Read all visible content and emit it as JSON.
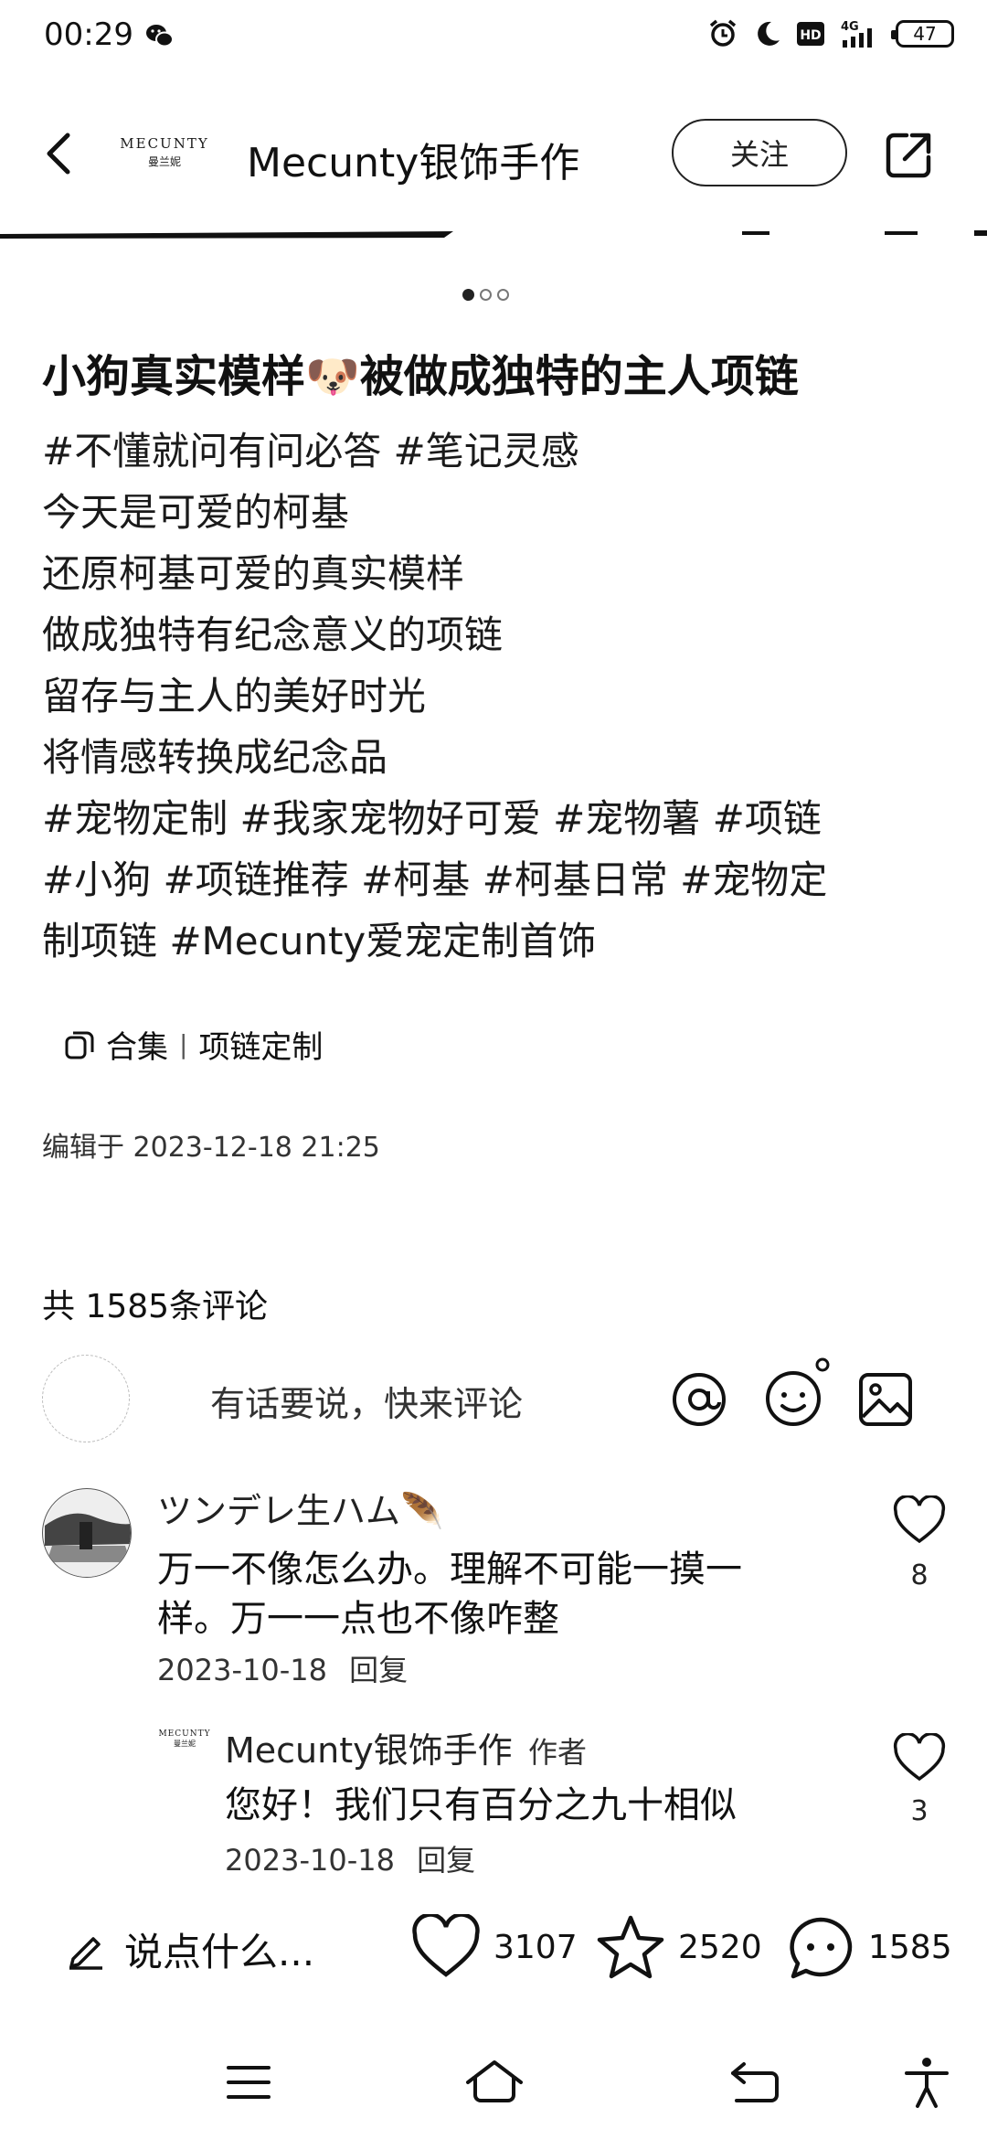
{
  "status_bar": {
    "time": "00:29",
    "network": "4G",
    "hd": "HD",
    "battery": "47"
  },
  "header": {
    "brand_logo_line1": "MECUNTY",
    "brand_logo_line2": "曼兰妮",
    "author_name": "Mecunty银饰手作",
    "follow_label": "关注"
  },
  "post": {
    "title": "小狗真实模样🐶被做成独特的主人项链",
    "body_lines": [
      "#不懂就问有问必答 #笔记灵感",
      "今天是可爱的柯基",
      "还原柯基可爱的真实模样",
      "做成独特有纪念意义的项链",
      "留存与主人的美好时光",
      "将情感转换成纪念品",
      "#宠物定制 #我家宠物好可爱 #宠物薯 #项链",
      "#小狗 #项链推荐 #柯基 #柯基日常 #宠物定",
      "制项链 #Mecunty爱宠定制首饰"
    ],
    "collection_label": "合集",
    "collection_name": "项链定制",
    "edit_time": "编辑于 2023-12-18 21:25"
  },
  "comments_section": {
    "count_text": "共 1585条评论",
    "input_placeholder": "有话要说，快来评论"
  },
  "comments": [
    {
      "user": "ツンデレ生ハム🪶",
      "text": "万一不像怎么办。理解不可能一摸一样。万一一点也不像咋整",
      "date": "2023-10-18",
      "reply_label": "回复",
      "likes": "8"
    },
    {
      "user": "Mecunty银饰手作",
      "author_tag": "作者",
      "avatar_line1": "MECUNTY",
      "avatar_line2": "曼兰妮",
      "text": "您好！我们只有百分之九十相似",
      "date": "2023-10-18",
      "reply_label": "回复",
      "likes": "3"
    }
  ],
  "actions": {
    "write_placeholder": "说点什么...",
    "likes": "3107",
    "stars": "2520",
    "comments": "1585"
  }
}
